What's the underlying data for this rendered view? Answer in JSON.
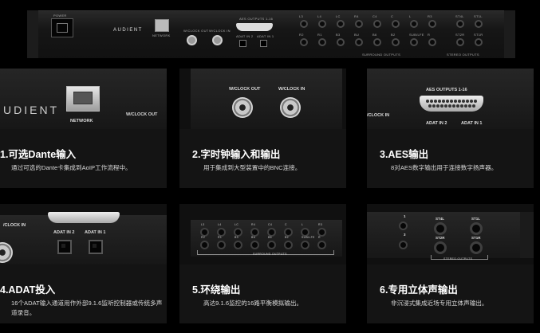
{
  "hero": {
    "brand": "AUDIENT",
    "power_label": "POWER",
    "network_label": "NETWORK",
    "wclock_out": "W/CLOCK OUT",
    "wclock_in": "W/CLOCK IN",
    "aes_label": "AES OUTPUTS 1-16",
    "adat_in2": "ADAT IN 2",
    "adat_in1": "ADAT IN 1",
    "surround_label": "SURROUND OUTPUTS",
    "stereo_label": "STEREO OUTPUTS",
    "jack_top": [
      "L3",
      "L4",
      "LC",
      "R4",
      "C4",
      "C",
      "L",
      "R3"
    ],
    "jack_bottom": [
      "R2",
      "R1",
      "B3",
      "BU",
      "B6",
      "B2",
      "SUB/LFE",
      "R"
    ],
    "stereo_top": [
      "ST4L",
      "ST1L"
    ],
    "stereo_bottom": [
      "ST2R",
      "ST1R"
    ]
  },
  "cards": [
    {
      "title": "1.可选Dante输入",
      "desc": "通过可选的Dante卡集成到AoIP工作流程中。",
      "img": {
        "brand": "UDIENT",
        "network": "NETWORK",
        "wclock": "W/CLOCK OUT"
      }
    },
    {
      "title": "2.字时钟输入和输出",
      "desc": "用于集成到大型装置中的BNC连接。",
      "img": {
        "out": "W/CLOCK OUT",
        "in": "W/CLOCK IN"
      }
    },
    {
      "title": "3.AES输出",
      "desc": "8对AES数字输出用于连接数字扬声器。",
      "img": {
        "aes": "AES OUTPUTS 1-16",
        "clock": "/CLOCK IN",
        "adat2": "ADAT IN 2",
        "adat1": "ADAT IN 1"
      }
    },
    {
      "title": "4.ADAT投入",
      "desc": "16个ADAT输入通道用作外部9.1.6监听控制器或传统多声道录音。",
      "img": {
        "clock": "/CLOCK IN",
        "adat2": "ADAT IN 2",
        "adat1": "ADAT IN 1"
      }
    },
    {
      "title": "5.环绕输出",
      "desc": "高达9.1.6监控的16路平衡模拟输出。",
      "img": {
        "surround": "SURROUND OUTPUTS"
      }
    },
    {
      "title": "6.专用立体声输出",
      "desc": "非沉浸式集成近场专用立体声输出。",
      "img": {
        "st4l": "ST4L",
        "st1l": "ST1L",
        "st2r": "ST2R",
        "st1r": "ST1R",
        "stereo": "STEREO OUTPUTS",
        "ch1": "1",
        "ch3": "3"
      }
    }
  ]
}
